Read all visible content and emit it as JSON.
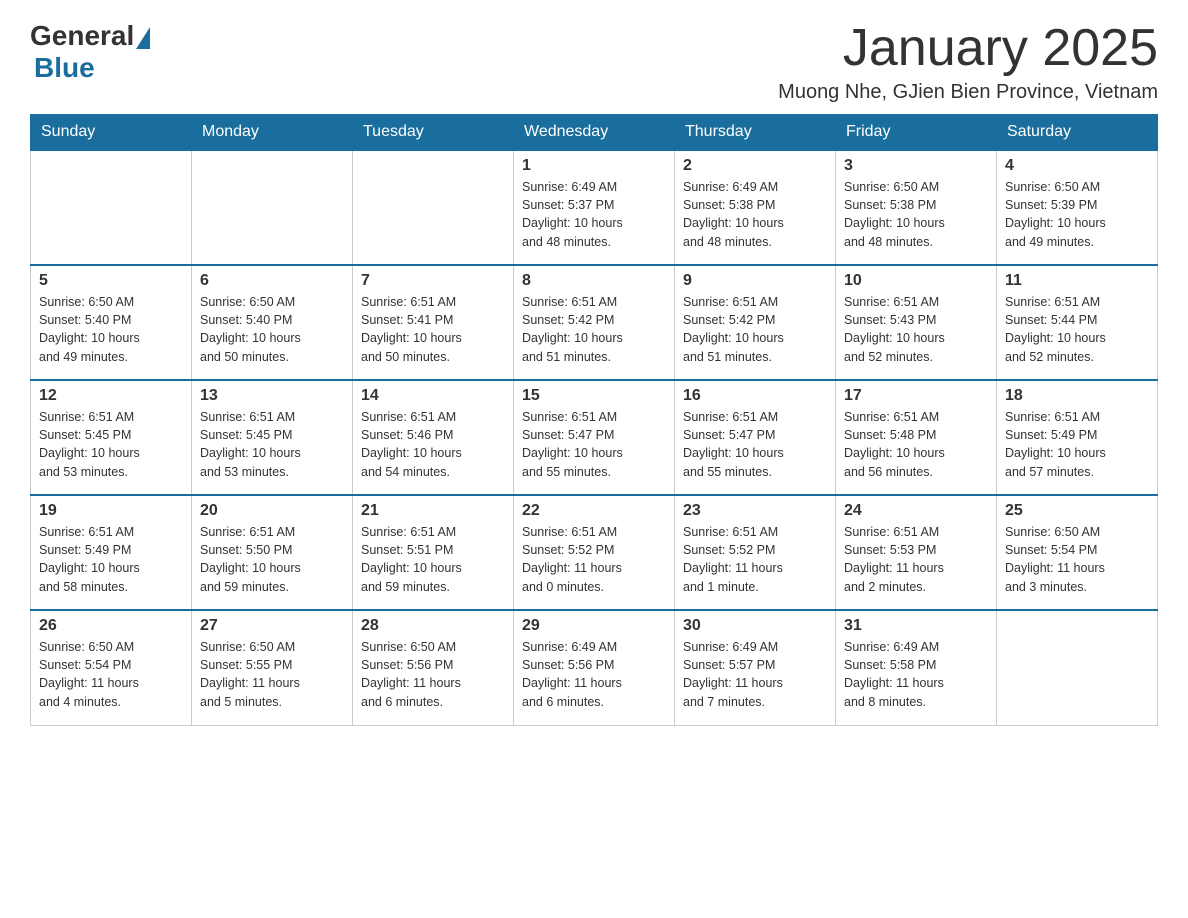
{
  "header": {
    "logo_general": "General",
    "logo_blue": "Blue",
    "month_title": "January 2025",
    "location": "Muong Nhe, GJien Bien Province, Vietnam"
  },
  "weekdays": [
    "Sunday",
    "Monday",
    "Tuesday",
    "Wednesday",
    "Thursday",
    "Friday",
    "Saturday"
  ],
  "weeks": [
    [
      {
        "day": "",
        "info": ""
      },
      {
        "day": "",
        "info": ""
      },
      {
        "day": "",
        "info": ""
      },
      {
        "day": "1",
        "info": "Sunrise: 6:49 AM\nSunset: 5:37 PM\nDaylight: 10 hours\nand 48 minutes."
      },
      {
        "day": "2",
        "info": "Sunrise: 6:49 AM\nSunset: 5:38 PM\nDaylight: 10 hours\nand 48 minutes."
      },
      {
        "day": "3",
        "info": "Sunrise: 6:50 AM\nSunset: 5:38 PM\nDaylight: 10 hours\nand 48 minutes."
      },
      {
        "day": "4",
        "info": "Sunrise: 6:50 AM\nSunset: 5:39 PM\nDaylight: 10 hours\nand 49 minutes."
      }
    ],
    [
      {
        "day": "5",
        "info": "Sunrise: 6:50 AM\nSunset: 5:40 PM\nDaylight: 10 hours\nand 49 minutes."
      },
      {
        "day": "6",
        "info": "Sunrise: 6:50 AM\nSunset: 5:40 PM\nDaylight: 10 hours\nand 50 minutes."
      },
      {
        "day": "7",
        "info": "Sunrise: 6:51 AM\nSunset: 5:41 PM\nDaylight: 10 hours\nand 50 minutes."
      },
      {
        "day": "8",
        "info": "Sunrise: 6:51 AM\nSunset: 5:42 PM\nDaylight: 10 hours\nand 51 minutes."
      },
      {
        "day": "9",
        "info": "Sunrise: 6:51 AM\nSunset: 5:42 PM\nDaylight: 10 hours\nand 51 minutes."
      },
      {
        "day": "10",
        "info": "Sunrise: 6:51 AM\nSunset: 5:43 PM\nDaylight: 10 hours\nand 52 minutes."
      },
      {
        "day": "11",
        "info": "Sunrise: 6:51 AM\nSunset: 5:44 PM\nDaylight: 10 hours\nand 52 minutes."
      }
    ],
    [
      {
        "day": "12",
        "info": "Sunrise: 6:51 AM\nSunset: 5:45 PM\nDaylight: 10 hours\nand 53 minutes."
      },
      {
        "day": "13",
        "info": "Sunrise: 6:51 AM\nSunset: 5:45 PM\nDaylight: 10 hours\nand 53 minutes."
      },
      {
        "day": "14",
        "info": "Sunrise: 6:51 AM\nSunset: 5:46 PM\nDaylight: 10 hours\nand 54 minutes."
      },
      {
        "day": "15",
        "info": "Sunrise: 6:51 AM\nSunset: 5:47 PM\nDaylight: 10 hours\nand 55 minutes."
      },
      {
        "day": "16",
        "info": "Sunrise: 6:51 AM\nSunset: 5:47 PM\nDaylight: 10 hours\nand 55 minutes."
      },
      {
        "day": "17",
        "info": "Sunrise: 6:51 AM\nSunset: 5:48 PM\nDaylight: 10 hours\nand 56 minutes."
      },
      {
        "day": "18",
        "info": "Sunrise: 6:51 AM\nSunset: 5:49 PM\nDaylight: 10 hours\nand 57 minutes."
      }
    ],
    [
      {
        "day": "19",
        "info": "Sunrise: 6:51 AM\nSunset: 5:49 PM\nDaylight: 10 hours\nand 58 minutes."
      },
      {
        "day": "20",
        "info": "Sunrise: 6:51 AM\nSunset: 5:50 PM\nDaylight: 10 hours\nand 59 minutes."
      },
      {
        "day": "21",
        "info": "Sunrise: 6:51 AM\nSunset: 5:51 PM\nDaylight: 10 hours\nand 59 minutes."
      },
      {
        "day": "22",
        "info": "Sunrise: 6:51 AM\nSunset: 5:52 PM\nDaylight: 11 hours\nand 0 minutes."
      },
      {
        "day": "23",
        "info": "Sunrise: 6:51 AM\nSunset: 5:52 PM\nDaylight: 11 hours\nand 1 minute."
      },
      {
        "day": "24",
        "info": "Sunrise: 6:51 AM\nSunset: 5:53 PM\nDaylight: 11 hours\nand 2 minutes."
      },
      {
        "day": "25",
        "info": "Sunrise: 6:50 AM\nSunset: 5:54 PM\nDaylight: 11 hours\nand 3 minutes."
      }
    ],
    [
      {
        "day": "26",
        "info": "Sunrise: 6:50 AM\nSunset: 5:54 PM\nDaylight: 11 hours\nand 4 minutes."
      },
      {
        "day": "27",
        "info": "Sunrise: 6:50 AM\nSunset: 5:55 PM\nDaylight: 11 hours\nand 5 minutes."
      },
      {
        "day": "28",
        "info": "Sunrise: 6:50 AM\nSunset: 5:56 PM\nDaylight: 11 hours\nand 6 minutes."
      },
      {
        "day": "29",
        "info": "Sunrise: 6:49 AM\nSunset: 5:56 PM\nDaylight: 11 hours\nand 6 minutes."
      },
      {
        "day": "30",
        "info": "Sunrise: 6:49 AM\nSunset: 5:57 PM\nDaylight: 11 hours\nand 7 minutes."
      },
      {
        "day": "31",
        "info": "Sunrise: 6:49 AM\nSunset: 5:58 PM\nDaylight: 11 hours\nand 8 minutes."
      },
      {
        "day": "",
        "info": ""
      }
    ]
  ]
}
